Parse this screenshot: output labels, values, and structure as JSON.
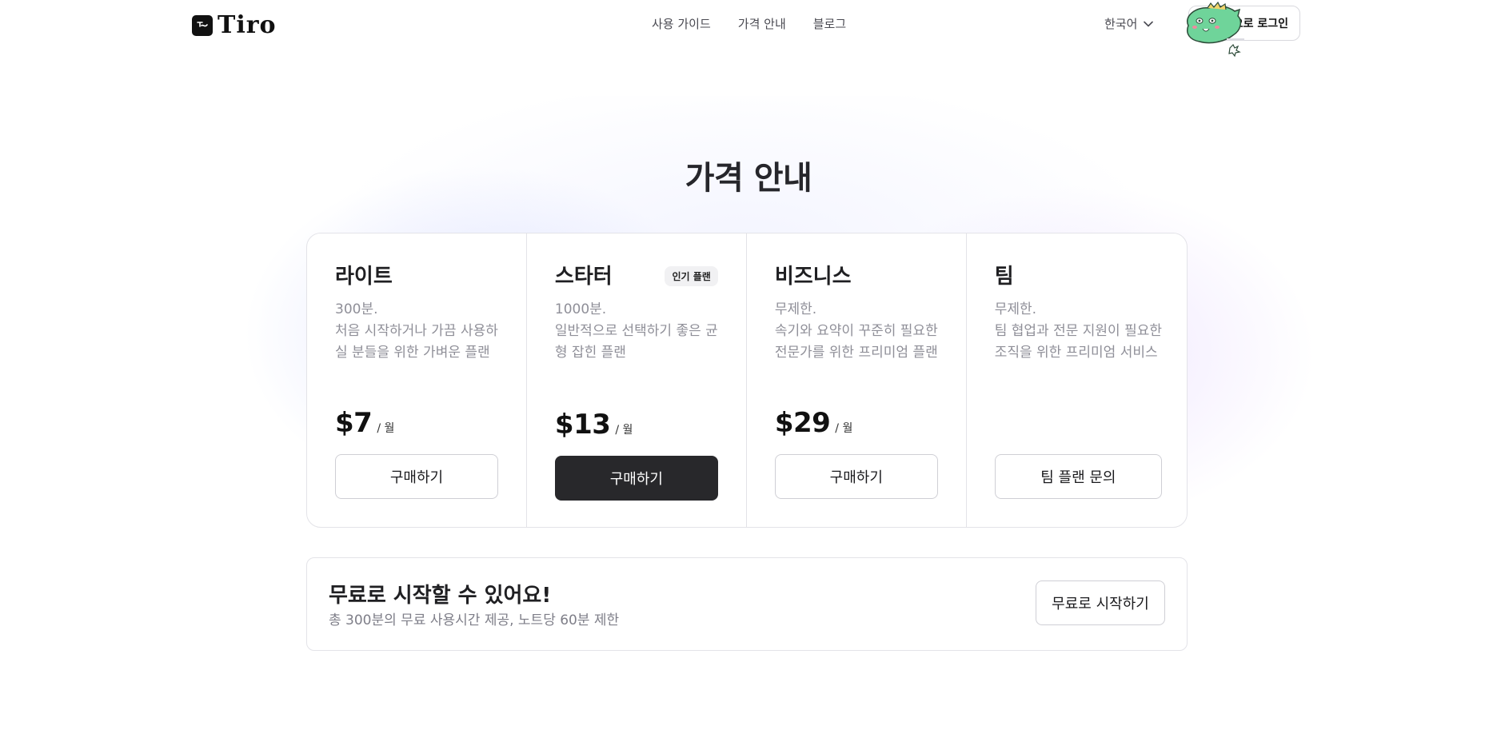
{
  "header": {
    "logo_text": "Tiro",
    "nav": [
      "사용 가이드",
      "가격 안내",
      "블로그"
    ],
    "language": "한국어",
    "login_label": "으로 로그인"
  },
  "page": {
    "title": "가격 안내"
  },
  "plans": [
    {
      "name": "라이트",
      "minutes": "300분.",
      "desc_lines": [
        "처음 시작하거나 가끔 사용하",
        "실 분들을 위한 가벼운 플랜"
      ],
      "price": "$7",
      "unit": "/ 월",
      "button": "구매하기"
    },
    {
      "name": "스타터",
      "badge": "인기 플랜",
      "minutes": "1000분.",
      "desc_lines": [
        "일반적으로 선택하기 좋은 균",
        "형 잡힌 플랜"
      ],
      "price": "$13",
      "unit": "/ 월",
      "button": "구매하기"
    },
    {
      "name": "비즈니스",
      "minutes": "무제한.",
      "desc_lines": [
        "속기와 요약이 꾸준히 필요한",
        "전문가를 위한 프리미엄 플랜"
      ],
      "price": "$29",
      "unit": "/ 월",
      "button": "구매하기"
    },
    {
      "name": "팀",
      "minutes": "무제한.",
      "desc_lines": [
        "팀 협업과 전문 지원이 필요한",
        "조직을 위한 프리미엄 서비스"
      ],
      "button": "팀 플랜 문의"
    }
  ],
  "free": {
    "title": "무료로 시작할 수 있어요!",
    "subtitle": "총 300분의 무료 사용시간 제공, 노트당 60분 제한",
    "button": "무료로 시작하기"
  },
  "colors": {
    "primary_button": "#28282b",
    "text_muted": "#8f8f98",
    "mascot_green": "#6fd49a"
  },
  "icons": {
    "logo": "tiro-logo-icon",
    "language_chevron": "chevron-down-icon",
    "mascot": "green-dinosaur-mascot"
  }
}
